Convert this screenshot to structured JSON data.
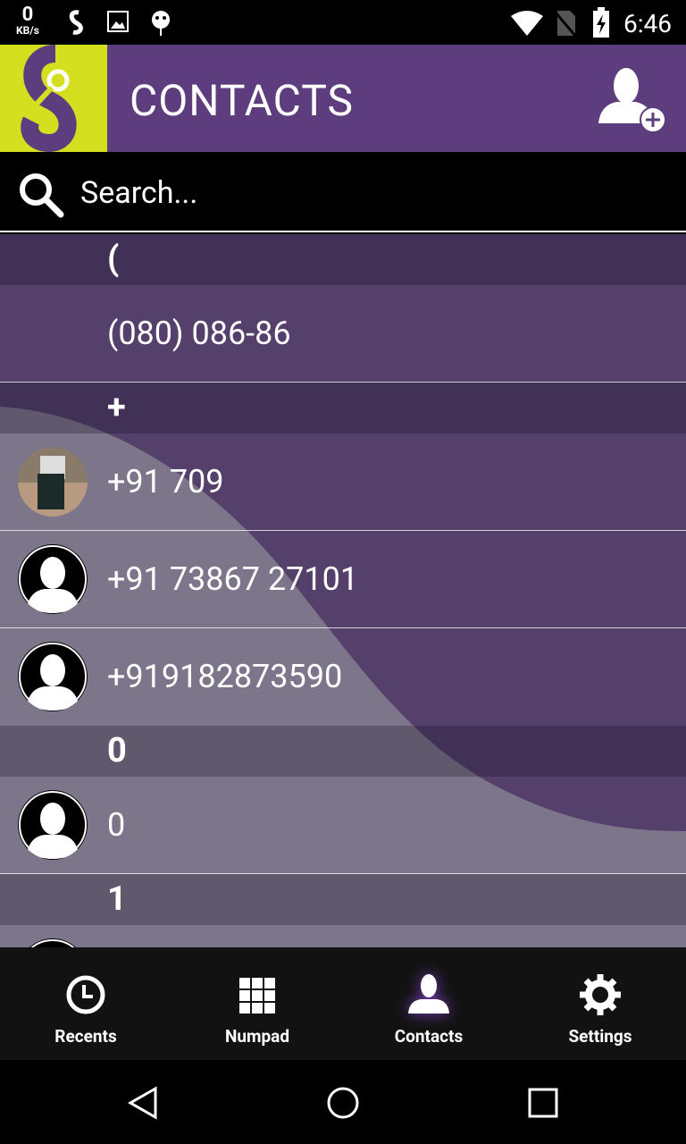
{
  "status_bar": {
    "speed_value": "0",
    "speed_unit": "KB/s",
    "time": "6:46",
    "icons": [
      "salsa-app-icon",
      "image-icon",
      "android-icon",
      "wifi-icon",
      "no-sim-icon",
      "battery-charging-icon"
    ]
  },
  "app_bar": {
    "title": "CONTACTS",
    "add_contact_icon": "add-contact-icon"
  },
  "search": {
    "placeholder": "Search..."
  },
  "colors": {
    "primary": "#5e3d7e",
    "logo_bg": "#d4df1f",
    "row": "#54406a",
    "wave": "#7d768a"
  },
  "contacts": {
    "sections": [
      {
        "letter": "(",
        "items": [
          {
            "name": "(080) 086-86",
            "avatar": "none"
          }
        ]
      },
      {
        "letter": "+",
        "items": [
          {
            "name": "+91 709",
            "avatar": "photo"
          },
          {
            "name": "+91 73867 27101",
            "avatar": "default"
          },
          {
            "name": "+919182873590",
            "avatar": "default"
          }
        ]
      },
      {
        "letter": "0",
        "items": [
          {
            "name": "0",
            "avatar": "default"
          }
        ]
      },
      {
        "letter": "1",
        "items": [
          {
            "name": "",
            "avatar": "default"
          }
        ]
      }
    ]
  },
  "bottom_nav": {
    "tabs": [
      {
        "label": "Recents",
        "icon": "clock-icon"
      },
      {
        "label": "Numpad",
        "icon": "grid-icon"
      },
      {
        "label": "Contacts",
        "icon": "person-icon",
        "active": true
      },
      {
        "label": "Settings",
        "icon": "gear-icon"
      }
    ]
  }
}
